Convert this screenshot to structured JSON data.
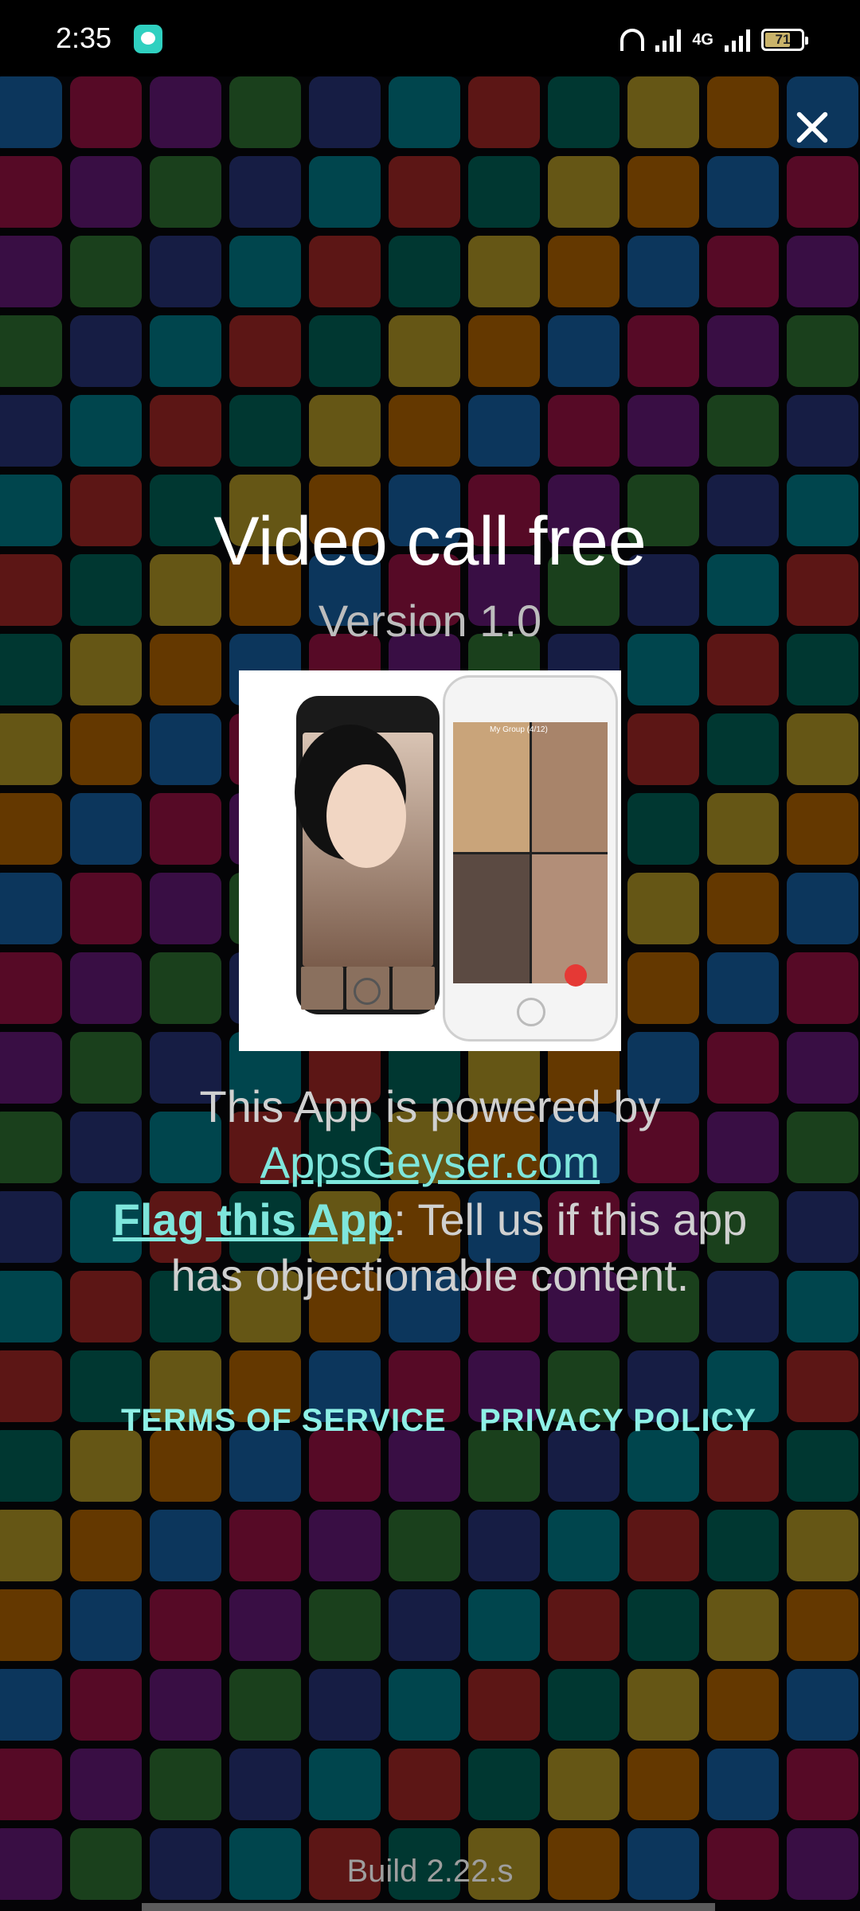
{
  "status_bar": {
    "time": "2:35",
    "network_label": "4G",
    "battery_level": "71"
  },
  "app": {
    "title": "Video call free",
    "version": "Version 1.0"
  },
  "promo": {
    "group_label": "My Group (4/12)"
  },
  "powered": {
    "line": "This App is powered by",
    "link": "AppsGeyser.com"
  },
  "flag": {
    "link": "Flag this App",
    "text": ": Tell us if this app",
    "text2": "has objectionable content."
  },
  "links": {
    "terms": "TERMS OF SERVICE",
    "privacy": "PRIVACY POLICY"
  },
  "build": "Build 2.22.s",
  "colors": {
    "accent": "#7ee6dc",
    "tile_palette": [
      "#1e88e5",
      "#43a047",
      "#e53935",
      "#fb8c00",
      "#8e24aa",
      "#00acc1",
      "#fdd835",
      "#d81b60",
      "#3949ab",
      "#00897b"
    ]
  },
  "icons": {
    "close": "close-icon",
    "headset": "headset-icon",
    "signal": "signal-icon",
    "battery": "battery-icon"
  }
}
